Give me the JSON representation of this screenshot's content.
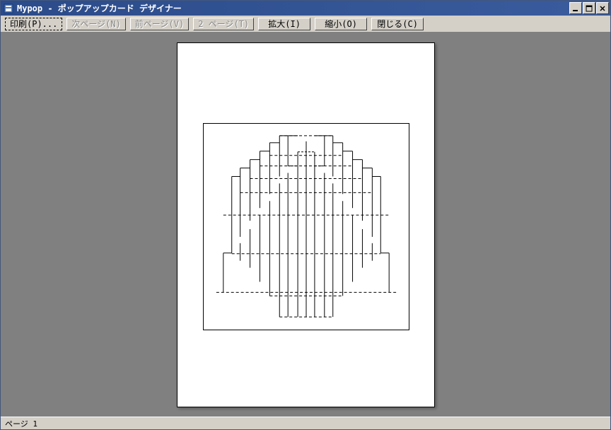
{
  "window": {
    "title": "Mypop - ポップアップカード デザイナー"
  },
  "toolbar": {
    "print": "印刷(P)...",
    "next": "次ページ(N)",
    "prev": "前ページ(V)",
    "twoPage": "2 ページ(T)",
    "zoomIn": "拡大(I)",
    "zoomOut": "縮小(O)",
    "close": "閉じる(C)"
  },
  "status": {
    "page": "ページ 1"
  }
}
